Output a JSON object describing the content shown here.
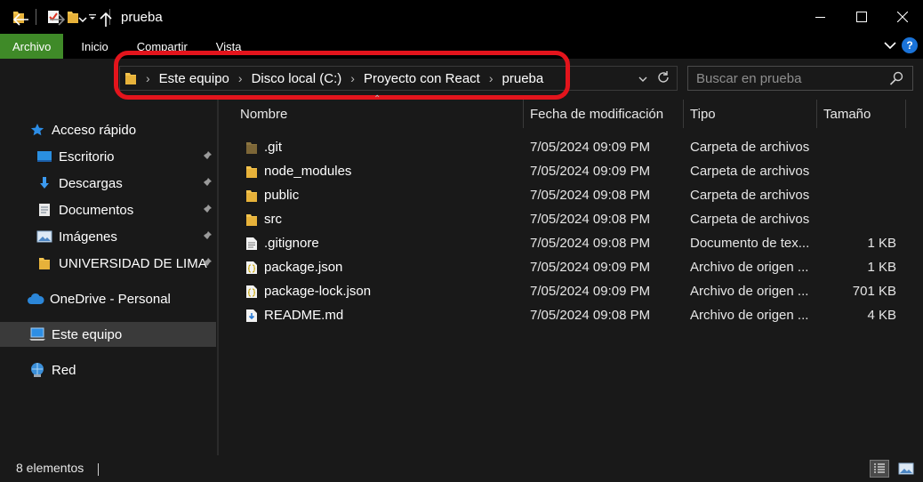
{
  "window": {
    "title": "prueba",
    "quick_access_icons": [
      "folder-icon",
      "properties-icon",
      "new-folder-icon",
      "customize-dropdown-icon"
    ]
  },
  "ribbon": {
    "tabs": [
      "Archivo",
      "Inicio",
      "Compartir",
      "Vista"
    ],
    "help_label": "?"
  },
  "navigation": {
    "breadcrumb": [
      "Este equipo",
      "Disco local (C:)",
      "Proyecto con React",
      "prueba"
    ],
    "search_placeholder": "Buscar en prueba"
  },
  "sidebar": {
    "items": [
      {
        "label": "Acceso rápido",
        "icon": "star-icon",
        "pinned": false
      },
      {
        "label": "Escritorio",
        "icon": "desktop-icon",
        "pinned": true
      },
      {
        "label": "Descargas",
        "icon": "download-icon",
        "pinned": true
      },
      {
        "label": "Documentos",
        "icon": "document-icon",
        "pinned": true
      },
      {
        "label": "Imágenes",
        "icon": "pictures-icon",
        "pinned": true
      },
      {
        "label": "UNIVERSIDAD DE LIMA",
        "icon": "folder-icon",
        "pinned": true
      },
      {
        "label": "OneDrive - Personal",
        "icon": "cloud-icon",
        "pinned": false
      },
      {
        "label": "Este equipo",
        "icon": "computer-icon",
        "pinned": false,
        "selected": true
      },
      {
        "label": "Red",
        "icon": "network-icon",
        "pinned": false
      }
    ]
  },
  "columns": {
    "name": "Nombre",
    "date": "Fecha de modificación",
    "type": "Tipo",
    "size": "Tamaño"
  },
  "files": [
    {
      "name": ".git",
      "date": "7/05/2024 09:09 PM",
      "type": "Carpeta de archivos",
      "size": "",
      "icon": "hidden-folder-icon"
    },
    {
      "name": "node_modules",
      "date": "7/05/2024 09:09 PM",
      "type": "Carpeta de archivos",
      "size": "",
      "icon": "folder-icon"
    },
    {
      "name": "public",
      "date": "7/05/2024 09:08 PM",
      "type": "Carpeta de archivos",
      "size": "",
      "icon": "folder-icon"
    },
    {
      "name": "src",
      "date": "7/05/2024 09:08 PM",
      "type": "Carpeta de archivos",
      "size": "",
      "icon": "folder-icon"
    },
    {
      "name": ".gitignore",
      "date": "7/05/2024 09:08 PM",
      "type": "Documento de tex...",
      "size": "1 KB",
      "icon": "text-file-icon"
    },
    {
      "name": "package.json",
      "date": "7/05/2024 09:09 PM",
      "type": "Archivo de origen ...",
      "size": "1 KB",
      "icon": "json-file-icon"
    },
    {
      "name": "package-lock.json",
      "date": "7/05/2024 09:09 PM",
      "type": "Archivo de origen ...",
      "size": "701 KB",
      "icon": "json-file-icon"
    },
    {
      "name": "README.md",
      "date": "7/05/2024 09:08 PM",
      "type": "Archivo de origen ...",
      "size": "4 KB",
      "icon": "markdown-file-icon"
    }
  ],
  "status": {
    "item_count": "8 elementos"
  },
  "colors": {
    "file_tab": "#3f8a28",
    "highlight_ring": "#e3141c",
    "folder": "#f3c34d",
    "background": "#191919"
  }
}
